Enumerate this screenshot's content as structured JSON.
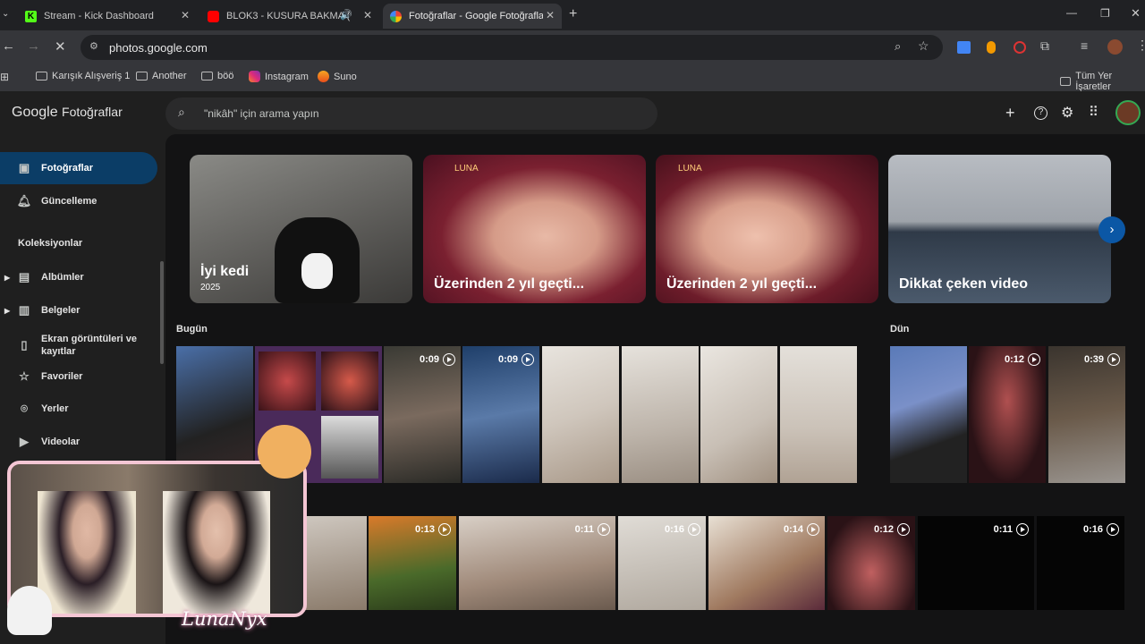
{
  "tabs": [
    {
      "title": "Stream - Kick Dashboard",
      "icon": "kick-icon"
    },
    {
      "title": "BLOK3 - KUSURA BAKMA (",
      "icon": "youtube-icon"
    },
    {
      "title": "Fotoğraflar - Google Fotoğrafla",
      "icon": "google-photos-icon"
    }
  ],
  "address": {
    "url": "photos.google.com"
  },
  "bookmarks": [
    "Karışık Alışveriş 1",
    "Another",
    "böö",
    "Instagram",
    "Suno"
  ],
  "bookmarks_right": "Tüm Yer İşaretler",
  "app": {
    "logo_google": "Google",
    "logo_product": "Fotoğraflar",
    "search_placeholder": "\"nikâh\" için arama yapın"
  },
  "sidebar": {
    "items": [
      {
        "label": "Fotoğraflar",
        "icon": "photo-icon"
      },
      {
        "label": "Güncelleme",
        "icon": "bell-icon"
      }
    ],
    "section": "Koleksiyonlar",
    "collections": [
      {
        "label": "Albümler",
        "icon": "album-icon"
      },
      {
        "label": "Belgeler",
        "icon": "document-icon"
      },
      {
        "label": "Ekran görüntüleri ve kayıtlar",
        "icon": "screenshot-icon"
      },
      {
        "label": "Favoriler",
        "icon": "star-icon"
      },
      {
        "label": "Yerler",
        "icon": "pin-icon"
      },
      {
        "label": "Videolar",
        "icon": "video-icon"
      }
    ]
  },
  "memories": [
    {
      "title": "İyi kedi",
      "subtitle": "2025"
    },
    {
      "title": "Üzerinden 2 yıl geçti...",
      "subtitle": ""
    },
    {
      "title": "Üzerinden 2 yıl geçti...",
      "subtitle": ""
    },
    {
      "title": "Dikkat çeken video",
      "subtitle": ""
    }
  ],
  "memory_overlay": "LUNA",
  "days": {
    "today": "Bugün",
    "yesterday": "Dün"
  },
  "row1_durations": [
    "0:09",
    "0:09"
  ],
  "row1_right_durations": [
    "0:12",
    "0:39"
  ],
  "row2_durations": [
    "0:13",
    "0:11",
    "0:16",
    "0:14",
    "0:12",
    "0:11",
    "0:16"
  ],
  "overlay": {
    "name": "LunaNyx"
  },
  "colors": {
    "accent": "#0b3d66",
    "bg": "#131314"
  }
}
